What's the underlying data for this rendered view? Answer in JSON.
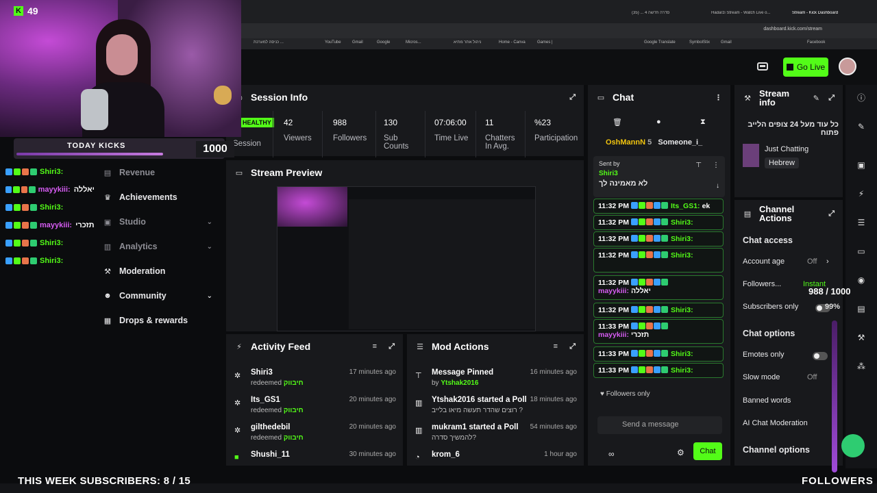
{
  "browser": {
    "tabs": [
      "סדרה חדשה 4 ... (35)",
      "Hadarzi Stream - Watch Live o...",
      "Stream - Kick Dashboard"
    ],
    "url": "dashboard.kick.com/stream",
    "bookmarks": [
      "כניסה למערכת ...",
      "YouTube",
      "Gmail",
      "Google",
      "Micros...",
      "ניהול אתר מתיא",
      "Home - Canva",
      "Games |",
      "Google Translate",
      "SymbolStix",
      "Gmail",
      "Facebook"
    ]
  },
  "header": {
    "go_live": "Go Live"
  },
  "overlay": {
    "kick_count": "49",
    "today_kicks_label": "TODAY KICKS",
    "today_kicks_value": "1000",
    "today_kicks_progress": 0.83,
    "chat": [
      {
        "user": "Shiri3:",
        "text": "",
        "color": "#53fc18"
      },
      {
        "user": "mayykiii:",
        "text": "יאללה",
        "color": "#d65cf2"
      },
      {
        "user": "Shiri3:",
        "text": "",
        "color": "#53fc18"
      },
      {
        "user": "mayykiii:",
        "text": "תזכרי",
        "color": "#d65cf2"
      },
      {
        "user": "Shiri3:",
        "text": "",
        "color": "#53fc18"
      },
      {
        "user": "Shiri3:",
        "text": "",
        "color": "#53fc18"
      }
    ],
    "bottom_banner": "THIS WEEK SUBSCRIBERS: 8 / 15",
    "followers_label": "FOLLOWERS",
    "followers_goal": "988 / 1000",
    "followers_goal_pct": "99%"
  },
  "nav": {
    "items": [
      {
        "label": "Revenue",
        "icon": "revenue-icon",
        "chevron": false,
        "dim": true
      },
      {
        "label": "Achievements",
        "icon": "trophy-icon",
        "chevron": false,
        "dim": false
      },
      {
        "label": "Studio",
        "icon": "studio-icon",
        "chevron": true,
        "dim": true
      },
      {
        "label": "Analytics",
        "icon": "analytics-icon",
        "chevron": true,
        "dim": true
      },
      {
        "label": "Moderation",
        "icon": "wrench-icon",
        "chevron": false,
        "dim": false
      },
      {
        "label": "Community",
        "icon": "community-icon",
        "chevron": true,
        "dim": false
      },
      {
        "label": "Drops & rewards",
        "icon": "gift-icon",
        "chevron": false,
        "dim": false
      }
    ]
  },
  "session": {
    "title": "Session Info",
    "health": "HEALTHY",
    "session_label": "Session",
    "stats": [
      {
        "value": "42",
        "label": "Viewers"
      },
      {
        "value": "988",
        "label": "Followers"
      },
      {
        "value": "130",
        "label": "Sub Counts"
      },
      {
        "value": "07:06:00",
        "label": "Time Live"
      },
      {
        "value": "11",
        "label": "Chatters In Avg."
      },
      {
        "value": "%23",
        "label": "Participation"
      }
    ]
  },
  "preview": {
    "title": "Stream Preview"
  },
  "activity": {
    "title": "Activity Feed",
    "items": [
      {
        "name": "Shiri3",
        "sub_prefix": "redeemed",
        "sub_reward": "חיבווק",
        "time": "17 minutes ago"
      },
      {
        "name": "Its_GS1",
        "sub_prefix": "redeemed",
        "sub_reward": "חיבווק",
        "time": "20 minutes ago"
      },
      {
        "name": "gilthedebil",
        "sub_prefix": "redeemed",
        "sub_reward": "חיבווק",
        "time": "20 minutes ago"
      },
      {
        "name": "Shushi_11",
        "sub_prefix": "",
        "sub_reward": "",
        "time": "30 minutes ago"
      }
    ]
  },
  "mod_actions": {
    "title": "Mod Actions",
    "items": [
      {
        "name": "Message Pinned",
        "sub": "by",
        "sub_user": "Ytshak2016",
        "time": "16 minutes ago"
      },
      {
        "name": "Ytshak2016 started a Poll",
        "sub": "רוצים שהדר תעשה מיאו בלייב ?",
        "sub_user": "",
        "time": "18 minutes ago"
      },
      {
        "name": "mukram1 started a Poll",
        "sub": "להמשיך סדרה?",
        "sub_user": "",
        "time": "54 minutes ago"
      },
      {
        "name": "krom_6",
        "sub": "",
        "sub_user": "",
        "time": "1 hour ago"
      }
    ]
  },
  "chat": {
    "title": "Chat",
    "top_chatters": [
      {
        "name": "OshMannN",
        "count": "5"
      },
      {
        "name": "Someone_i_"
      }
    ],
    "pinned": {
      "label": "Sent by",
      "user": "Shiri3",
      "text": "לא מאמינה לך"
    },
    "messages": [
      {
        "time": "11:32 PM",
        "user": "Its_GS1:",
        "text": "ek",
        "color": "#53fc18",
        "tall": false
      },
      {
        "time": "11:32 PM",
        "user": "Shiri3:",
        "text": "",
        "color": "#53fc18",
        "tall": false
      },
      {
        "time": "11:32 PM",
        "user": "Shiri3:",
        "text": "",
        "color": "#53fc18",
        "tall": false
      },
      {
        "time": "11:32 PM",
        "user": "Shiri3:",
        "text": "",
        "color": "#53fc18",
        "tall": true
      },
      {
        "time": "11:32 PM",
        "user": "mayykiii:",
        "text": "יאללה",
        "color": "#d65cf2",
        "tall": true
      },
      {
        "time": "11:32 PM",
        "user": "Shiri3:",
        "text": "",
        "color": "#53fc18",
        "tall": false
      },
      {
        "time": "11:33 PM",
        "user": "mayykiii:",
        "text": "תזכרי",
        "color": "#d65cf2",
        "tall": true
      },
      {
        "time": "11:33 PM",
        "user": "Shiri3:",
        "text": "",
        "color": "#53fc18",
        "tall": false
      },
      {
        "time": "11:33 PM",
        "user": "Shiri3:",
        "text": "",
        "color": "#53fc18",
        "tall": false
      }
    ],
    "followers_only": "Followers only",
    "send_placeholder": "Send a message",
    "send_button": "Chat"
  },
  "stream_info": {
    "title": "Stream info",
    "stream_title": "כל עוד מעל 24 צופים הלייב פתוח",
    "category": "Just Chatting",
    "language": "Hebrew"
  },
  "channel_actions": {
    "title": "Channel Actions",
    "chat_access": "Chat access",
    "account_age_label": "Account age",
    "account_age_value": "Off",
    "followers_label": "Followers...",
    "followers_value": "Instant",
    "subscribers_only": "Subscribers only",
    "chat_options": "Chat options",
    "emotes_only": "Emotes only",
    "slow_mode": "Slow mode",
    "slow_mode_value": "Off",
    "banned_words": "Banned words",
    "ai_moderation": "AI Chat Moderation",
    "channel_options": "Channel options"
  }
}
